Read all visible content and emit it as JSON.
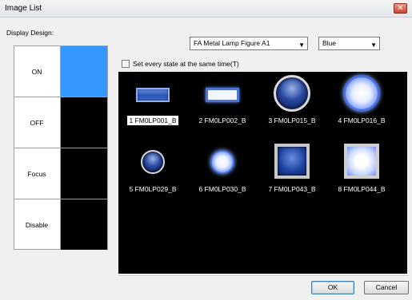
{
  "window": {
    "title": "Image List",
    "close_glyph": "✕"
  },
  "display_design": {
    "label": "Display Design:",
    "states": [
      {
        "label": "ON"
      },
      {
        "label": "OFF"
      },
      {
        "label": "Focus"
      },
      {
        "label": "Disable"
      }
    ]
  },
  "design_select": {
    "value": "FA Metal Lamp Figure A1",
    "arrow": "▼"
  },
  "color_select": {
    "value": "Blue",
    "arrow": "▼"
  },
  "same_time_checkbox": {
    "label": "Set every state at the same time(T)",
    "checked": false
  },
  "images": [
    {
      "caption": "1 FM0LP001_B",
      "icon": "rect-lamp-dim"
    },
    {
      "caption": "2 FM0LP002_B",
      "icon": "rect-lamp-bright"
    },
    {
      "caption": "3 FM0LP015_B",
      "icon": "round-lamp-dim-large"
    },
    {
      "caption": "4 FM0LP016_B",
      "icon": "round-lamp-bright-large"
    },
    {
      "caption": "5 FM0LP029_B",
      "icon": "round-lamp-dim-small"
    },
    {
      "caption": "6 FM0LP030_B",
      "icon": "round-lamp-bright-small"
    },
    {
      "caption": "7 FM0LP043_B",
      "icon": "square-lamp-dim"
    },
    {
      "caption": "8 FM0LP044_B",
      "icon": "square-lamp-bright"
    }
  ],
  "buttons": {
    "ok": "OK",
    "cancel": "Cancel"
  },
  "colors": {
    "selected_state": "#3399ff",
    "gallery_bg": "#000000",
    "lamp_blue": "#3b63d1"
  }
}
